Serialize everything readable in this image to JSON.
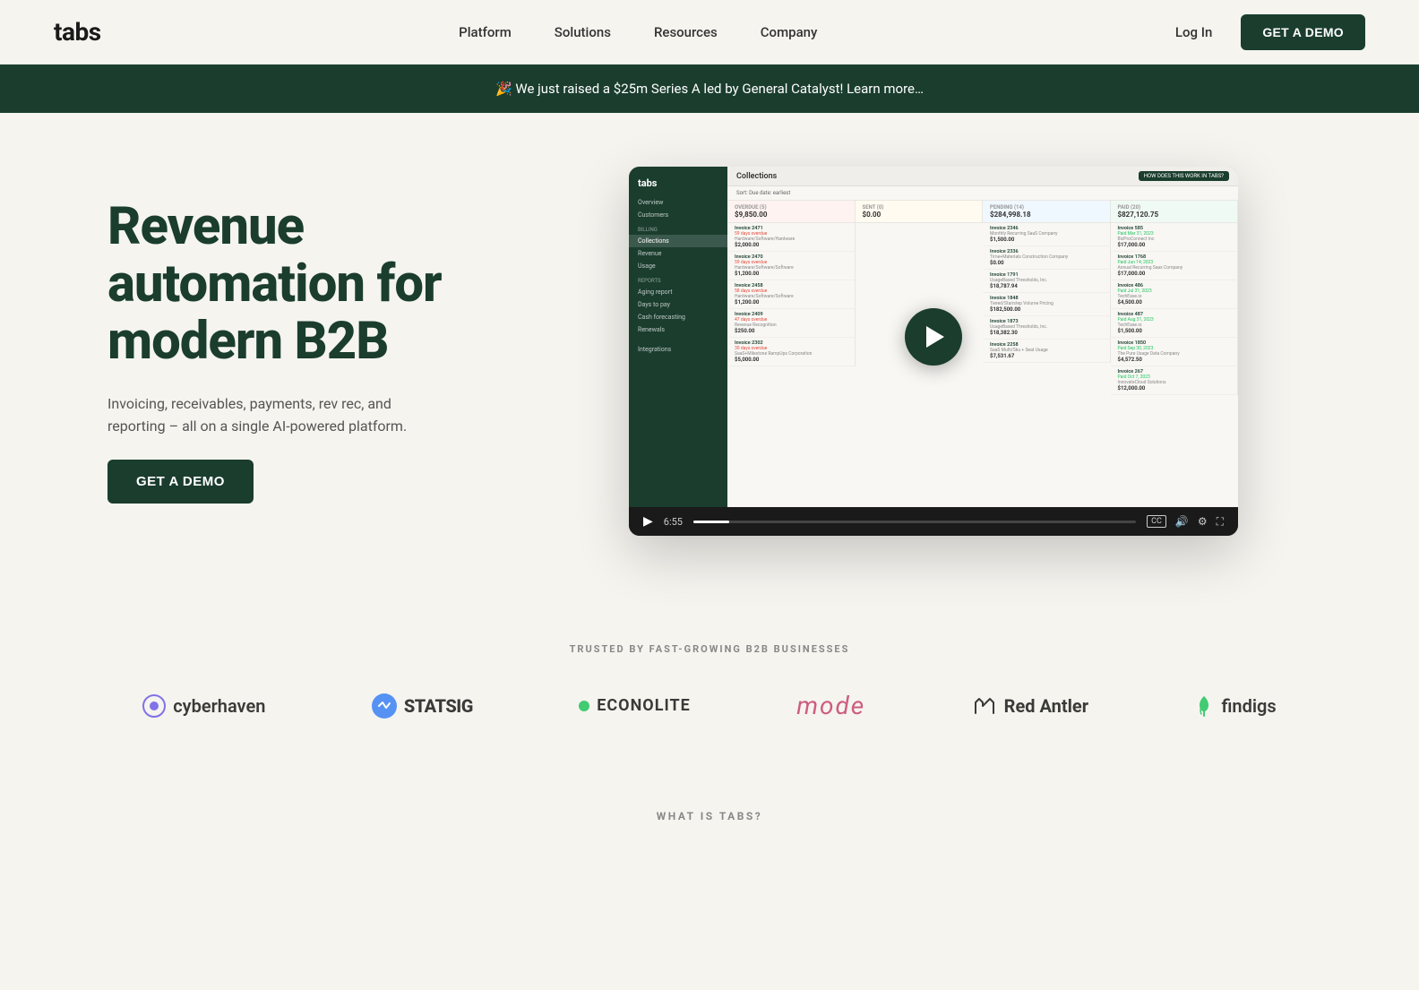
{
  "nav": {
    "logo": "tabs",
    "links": [
      {
        "label": "Platform",
        "id": "platform"
      },
      {
        "label": "Solutions",
        "id": "solutions"
      },
      {
        "label": "Resources",
        "id": "resources"
      },
      {
        "label": "Company",
        "id": "company"
      }
    ],
    "login": "Log In",
    "cta": "GET A DEMO"
  },
  "banner": {
    "emoji": "🎉",
    "text": "We just raised a $25m Series A led by General Catalyst! Learn more…"
  },
  "hero": {
    "headline_line1": "Revenue",
    "headline_line2": "automation for",
    "headline_line3": "modern B2B",
    "subtext": "Invoicing, receivables, payments, rev rec, and reporting – all on a single AI-powered platform.",
    "cta": "GET A DEMO"
  },
  "video": {
    "time": "6:55",
    "app": {
      "sidebar_logo": "tabs",
      "sidebar_items": [
        {
          "label": "Overview",
          "active": false
        },
        {
          "label": "Customers",
          "active": false
        },
        {
          "label": "Billing",
          "active": false,
          "section": true
        },
        {
          "label": "Collections",
          "active": true
        },
        {
          "label": "Revenue",
          "active": false
        },
        {
          "label": "Usage",
          "active": false
        },
        {
          "label": "Reports",
          "active": false,
          "section": true
        },
        {
          "label": "Aging report",
          "active": false
        },
        {
          "label": "Days to pay",
          "active": false
        },
        {
          "label": "Cash forecasting",
          "active": false
        },
        {
          "label": "Renewals",
          "active": false
        },
        {
          "label": "Integrations",
          "active": false,
          "section": true
        }
      ],
      "header_title": "Collections",
      "header_btn": "HOW DOES THIS WORK IN TABS?",
      "sort_label": "Sort: Due date: earliest",
      "columns": [
        {
          "id": "overdue",
          "label": "OVERDUE (5)",
          "amount": "$9,850.00",
          "invoices": [
            {
              "num": "Invoice 2471",
              "desc": "Hardware/Software/Hardware",
              "amount": "$2,000.00",
              "tag": "59 days overdue"
            },
            {
              "num": "Invoice 2470",
              "desc": "Hardware/Software/Software",
              "amount": "$1,200.00",
              "tag": "59 days overdue"
            },
            {
              "num": "Invoice 2458",
              "desc": "Hardware/Software/Software",
              "amount": "$1,200.00",
              "tag": "58 days overdue"
            },
            {
              "num": "Invoice 2409",
              "desc": "Revenue Recognition",
              "amount": "$250.00",
              "tag": "47 days overdue"
            },
            {
              "num": "Invoice 2302",
              "desc": "SaaS+Milestone RampUps Corporation",
              "amount": "$5,000.00",
              "tag": "30 days overdue"
            }
          ]
        },
        {
          "id": "sent",
          "label": "SENT (0)",
          "amount": "$0.00",
          "invoices": []
        },
        {
          "id": "pending",
          "label": "PENDING (14)",
          "amount": "$284,998.18",
          "invoices": [
            {
              "num": "Invoice 2346",
              "desc": "Monthly Recurring SaaS Company",
              "amount": "$1,500.00"
            },
            {
              "num": "Invoice 2336",
              "desc": "Time+Materials Construction Company",
              "amount": "$0.00"
            },
            {
              "num": "Invoice 1791",
              "desc": "UsageBased Thresholds, Inc.",
              "amount": "$18,787.94"
            },
            {
              "num": "Invoice 1848",
              "desc": "Tiered/Stairstep Volume Pricing",
              "amount": "$182,500.00"
            },
            {
              "num": "Invoice 1873",
              "desc": "UsageBased Thresholds, Inc.",
              "amount": "$18,382.30"
            },
            {
              "num": "Invoice 2258",
              "desc": "SaaS Multi/Sku + Seat Usage",
              "amount": "$7,531.67"
            }
          ]
        },
        {
          "id": "paid",
          "label": "PAID (20)",
          "amount": "$827,120.75",
          "invoices": [
            {
              "num": "Invoice 585",
              "desc": "BizProConnect Inc",
              "amount": "$17,000.00",
              "tag": "Paid Mar 31, 2023"
            },
            {
              "num": "Invoice 1768",
              "desc": "Annual Recurring Saas Company",
              "amount": "$17,000.00",
              "tag": "Paid Jun 14, 2023"
            },
            {
              "num": "Invoice 486",
              "desc": "TechEase.io",
              "amount": "$4,500.00",
              "tag": "Paid Jul 31, 2023"
            },
            {
              "num": "Invoice 487",
              "desc": "TechEase.io",
              "amount": "$1,500.00",
              "tag": "Paid Aug 31, 2023"
            },
            {
              "num": "Invoice 1850",
              "desc": "The Pure Usage Data Company",
              "amount": "$4,572.50",
              "tag": "Paid Sep 30, 2023"
            },
            {
              "num": "Invoice 267",
              "desc": "InnovateCloud Solutions",
              "amount": "$12,000.00",
              "tag": "Paid Oct 7, 2023"
            }
          ]
        }
      ]
    }
  },
  "trusted": {
    "label": "TRUSTED BY FAST-GROWING B2B BUSINESSES",
    "logos": [
      {
        "name": "cyberhaven",
        "text": "cyberhaven"
      },
      {
        "name": "statsig",
        "text": "STATSIG"
      },
      {
        "name": "econolite",
        "text": "ECONOLITE"
      },
      {
        "name": "mode",
        "text": "mode"
      },
      {
        "name": "redantler",
        "text": "Red Antler"
      },
      {
        "name": "findigs",
        "text": "findigs"
      }
    ]
  },
  "what": {
    "label": "WHAT IS TABS?"
  }
}
